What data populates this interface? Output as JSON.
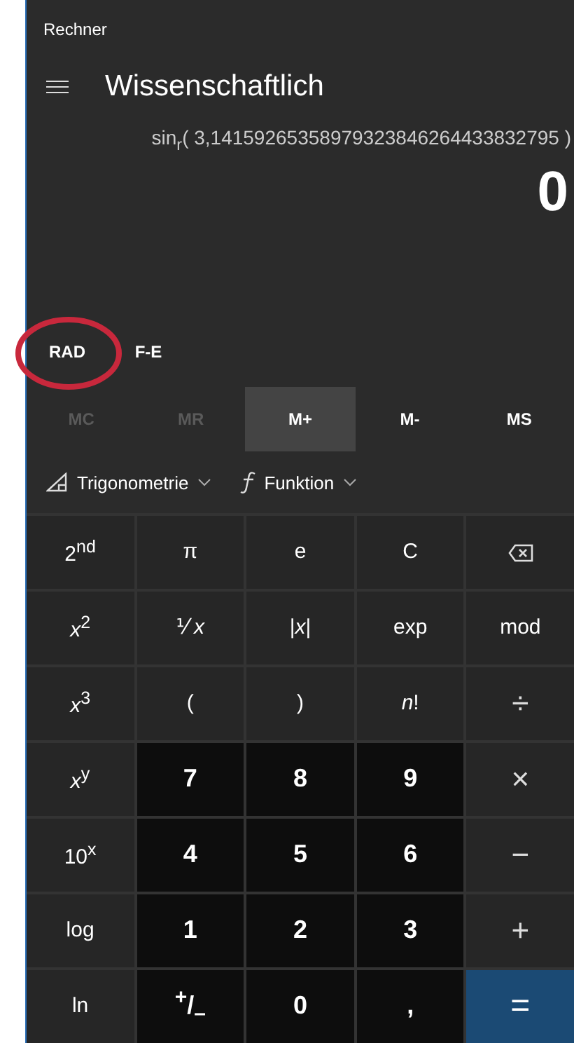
{
  "window": {
    "title": "Rechner"
  },
  "header": {
    "title": "Wissenschaftlich"
  },
  "display": {
    "expression": "sin$_{r}$( 3,14159265358979323846264433832795 )",
    "value": "0"
  },
  "modes": [
    {
      "label": "RAD",
      "circled": true
    },
    {
      "label": "F-E",
      "circled": false
    }
  ],
  "memory": [
    {
      "label": "MC",
      "disabled": true,
      "highlighted": false
    },
    {
      "label": "MR",
      "disabled": true,
      "highlighted": false
    },
    {
      "label": "M+",
      "disabled": false,
      "highlighted": true
    },
    {
      "label": "M-",
      "disabled": false,
      "highlighted": false
    },
    {
      "label": "MS",
      "disabled": false,
      "highlighted": false
    }
  ],
  "menus": [
    {
      "kind": "trig",
      "label": "Trigonometrie"
    },
    {
      "kind": "function",
      "label": "Funktion"
    }
  ],
  "keys": [
    {
      "kind": "fn",
      "label": "2$^{nd}$"
    },
    {
      "kind": "fn",
      "label": "π"
    },
    {
      "kind": "fn",
      "label": "e"
    },
    {
      "kind": "fn",
      "label": "C"
    },
    {
      "kind": "backspace"
    },
    {
      "kind": "fn",
      "label": "*x*$^{2}$"
    },
    {
      "kind": "fn",
      "label": "⅟ *x*"
    },
    {
      "kind": "fn",
      "label": "|*x*|"
    },
    {
      "kind": "fn",
      "label": "exp"
    },
    {
      "kind": "fn",
      "label": "mod"
    },
    {
      "kind": "fn",
      "label": "*x*$^{3}$"
    },
    {
      "kind": "fn",
      "label": "("
    },
    {
      "kind": "fn",
      "label": ")"
    },
    {
      "kind": "fn",
      "label": "*n*!"
    },
    {
      "kind": "op",
      "label": "÷"
    },
    {
      "kind": "fn",
      "label": "*x*$^{y}$"
    },
    {
      "kind": "digit",
      "label": "7"
    },
    {
      "kind": "digit",
      "label": "8"
    },
    {
      "kind": "digit",
      "label": "9"
    },
    {
      "kind": "op",
      "label": "×"
    },
    {
      "kind": "fn",
      "label": "10$^{x}$"
    },
    {
      "kind": "digit",
      "label": "4"
    },
    {
      "kind": "digit",
      "label": "5"
    },
    {
      "kind": "digit",
      "label": "6"
    },
    {
      "kind": "op",
      "label": "−"
    },
    {
      "kind": "fn",
      "label": "log"
    },
    {
      "kind": "digit",
      "label": "1"
    },
    {
      "kind": "digit",
      "label": "2"
    },
    {
      "kind": "digit",
      "label": "3"
    },
    {
      "kind": "op",
      "label": "+"
    },
    {
      "kind": "fn",
      "label": "ln"
    },
    {
      "kind": "digit",
      "label": "$^{+}$/$_{–}$"
    },
    {
      "kind": "digit",
      "label": "0"
    },
    {
      "kind": "digit",
      "label": ","
    },
    {
      "kind": "equals",
      "label": "="
    }
  ]
}
